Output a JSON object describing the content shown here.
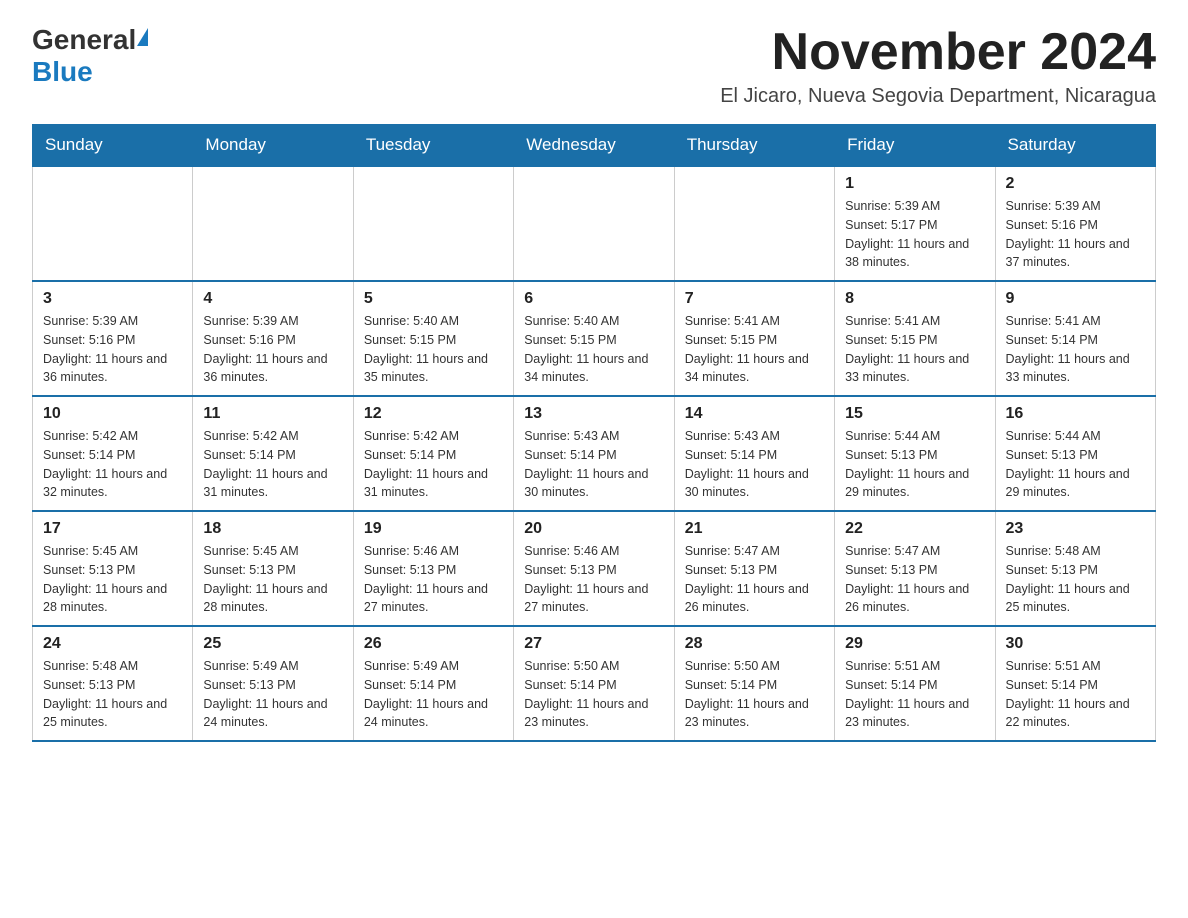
{
  "logo": {
    "general": "General",
    "blue": "Blue"
  },
  "header": {
    "month": "November 2024",
    "location": "El Jicaro, Nueva Segovia Department, Nicaragua"
  },
  "weekdays": [
    "Sunday",
    "Monday",
    "Tuesday",
    "Wednesday",
    "Thursday",
    "Friday",
    "Saturday"
  ],
  "weeks": [
    [
      {
        "day": "",
        "sunrise": "",
        "sunset": "",
        "daylight": ""
      },
      {
        "day": "",
        "sunrise": "",
        "sunset": "",
        "daylight": ""
      },
      {
        "day": "",
        "sunrise": "",
        "sunset": "",
        "daylight": ""
      },
      {
        "day": "",
        "sunrise": "",
        "sunset": "",
        "daylight": ""
      },
      {
        "day": "",
        "sunrise": "",
        "sunset": "",
        "daylight": ""
      },
      {
        "day": "1",
        "sunrise": "Sunrise: 5:39 AM",
        "sunset": "Sunset: 5:17 PM",
        "daylight": "Daylight: 11 hours and 38 minutes."
      },
      {
        "day": "2",
        "sunrise": "Sunrise: 5:39 AM",
        "sunset": "Sunset: 5:16 PM",
        "daylight": "Daylight: 11 hours and 37 minutes."
      }
    ],
    [
      {
        "day": "3",
        "sunrise": "Sunrise: 5:39 AM",
        "sunset": "Sunset: 5:16 PM",
        "daylight": "Daylight: 11 hours and 36 minutes."
      },
      {
        "day": "4",
        "sunrise": "Sunrise: 5:39 AM",
        "sunset": "Sunset: 5:16 PM",
        "daylight": "Daylight: 11 hours and 36 minutes."
      },
      {
        "day": "5",
        "sunrise": "Sunrise: 5:40 AM",
        "sunset": "Sunset: 5:15 PM",
        "daylight": "Daylight: 11 hours and 35 minutes."
      },
      {
        "day": "6",
        "sunrise": "Sunrise: 5:40 AM",
        "sunset": "Sunset: 5:15 PM",
        "daylight": "Daylight: 11 hours and 34 minutes."
      },
      {
        "day": "7",
        "sunrise": "Sunrise: 5:41 AM",
        "sunset": "Sunset: 5:15 PM",
        "daylight": "Daylight: 11 hours and 34 minutes."
      },
      {
        "day": "8",
        "sunrise": "Sunrise: 5:41 AM",
        "sunset": "Sunset: 5:15 PM",
        "daylight": "Daylight: 11 hours and 33 minutes."
      },
      {
        "day": "9",
        "sunrise": "Sunrise: 5:41 AM",
        "sunset": "Sunset: 5:14 PM",
        "daylight": "Daylight: 11 hours and 33 minutes."
      }
    ],
    [
      {
        "day": "10",
        "sunrise": "Sunrise: 5:42 AM",
        "sunset": "Sunset: 5:14 PM",
        "daylight": "Daylight: 11 hours and 32 minutes."
      },
      {
        "day": "11",
        "sunrise": "Sunrise: 5:42 AM",
        "sunset": "Sunset: 5:14 PM",
        "daylight": "Daylight: 11 hours and 31 minutes."
      },
      {
        "day": "12",
        "sunrise": "Sunrise: 5:42 AM",
        "sunset": "Sunset: 5:14 PM",
        "daylight": "Daylight: 11 hours and 31 minutes."
      },
      {
        "day": "13",
        "sunrise": "Sunrise: 5:43 AM",
        "sunset": "Sunset: 5:14 PM",
        "daylight": "Daylight: 11 hours and 30 minutes."
      },
      {
        "day": "14",
        "sunrise": "Sunrise: 5:43 AM",
        "sunset": "Sunset: 5:14 PM",
        "daylight": "Daylight: 11 hours and 30 minutes."
      },
      {
        "day": "15",
        "sunrise": "Sunrise: 5:44 AM",
        "sunset": "Sunset: 5:13 PM",
        "daylight": "Daylight: 11 hours and 29 minutes."
      },
      {
        "day": "16",
        "sunrise": "Sunrise: 5:44 AM",
        "sunset": "Sunset: 5:13 PM",
        "daylight": "Daylight: 11 hours and 29 minutes."
      }
    ],
    [
      {
        "day": "17",
        "sunrise": "Sunrise: 5:45 AM",
        "sunset": "Sunset: 5:13 PM",
        "daylight": "Daylight: 11 hours and 28 minutes."
      },
      {
        "day": "18",
        "sunrise": "Sunrise: 5:45 AM",
        "sunset": "Sunset: 5:13 PM",
        "daylight": "Daylight: 11 hours and 28 minutes."
      },
      {
        "day": "19",
        "sunrise": "Sunrise: 5:46 AM",
        "sunset": "Sunset: 5:13 PM",
        "daylight": "Daylight: 11 hours and 27 minutes."
      },
      {
        "day": "20",
        "sunrise": "Sunrise: 5:46 AM",
        "sunset": "Sunset: 5:13 PM",
        "daylight": "Daylight: 11 hours and 27 minutes."
      },
      {
        "day": "21",
        "sunrise": "Sunrise: 5:47 AM",
        "sunset": "Sunset: 5:13 PM",
        "daylight": "Daylight: 11 hours and 26 minutes."
      },
      {
        "day": "22",
        "sunrise": "Sunrise: 5:47 AM",
        "sunset": "Sunset: 5:13 PM",
        "daylight": "Daylight: 11 hours and 26 minutes."
      },
      {
        "day": "23",
        "sunrise": "Sunrise: 5:48 AM",
        "sunset": "Sunset: 5:13 PM",
        "daylight": "Daylight: 11 hours and 25 minutes."
      }
    ],
    [
      {
        "day": "24",
        "sunrise": "Sunrise: 5:48 AM",
        "sunset": "Sunset: 5:13 PM",
        "daylight": "Daylight: 11 hours and 25 minutes."
      },
      {
        "day": "25",
        "sunrise": "Sunrise: 5:49 AM",
        "sunset": "Sunset: 5:13 PM",
        "daylight": "Daylight: 11 hours and 24 minutes."
      },
      {
        "day": "26",
        "sunrise": "Sunrise: 5:49 AM",
        "sunset": "Sunset: 5:14 PM",
        "daylight": "Daylight: 11 hours and 24 minutes."
      },
      {
        "day": "27",
        "sunrise": "Sunrise: 5:50 AM",
        "sunset": "Sunset: 5:14 PM",
        "daylight": "Daylight: 11 hours and 23 minutes."
      },
      {
        "day": "28",
        "sunrise": "Sunrise: 5:50 AM",
        "sunset": "Sunset: 5:14 PM",
        "daylight": "Daylight: 11 hours and 23 minutes."
      },
      {
        "day": "29",
        "sunrise": "Sunrise: 5:51 AM",
        "sunset": "Sunset: 5:14 PM",
        "daylight": "Daylight: 11 hours and 23 minutes."
      },
      {
        "day": "30",
        "sunrise": "Sunrise: 5:51 AM",
        "sunset": "Sunset: 5:14 PM",
        "daylight": "Daylight: 11 hours and 22 minutes."
      }
    ]
  ]
}
